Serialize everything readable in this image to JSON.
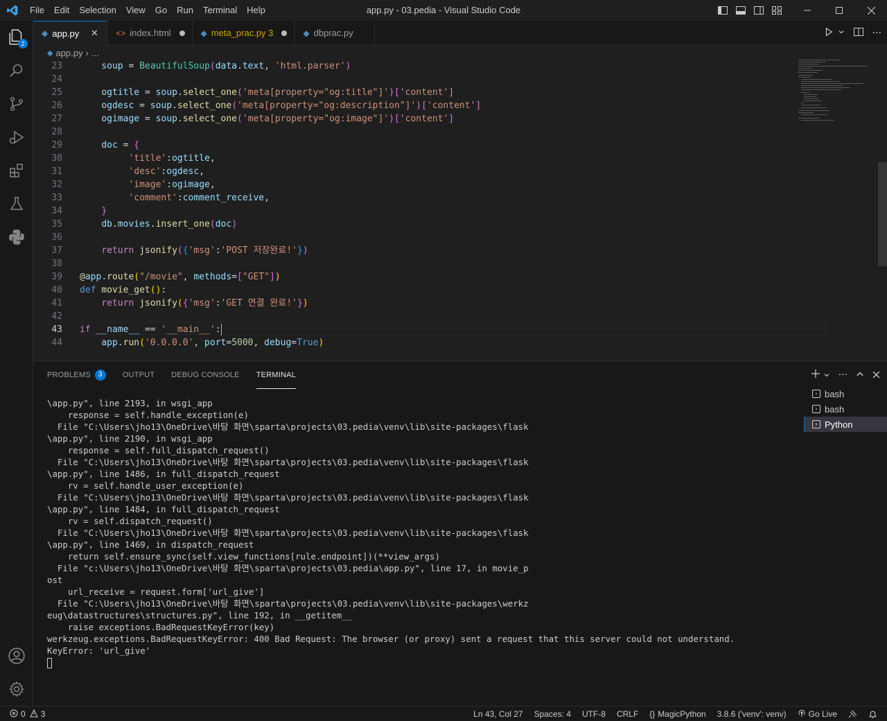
{
  "titlebar": {
    "menu": [
      "File",
      "Edit",
      "Selection",
      "View",
      "Go",
      "Run",
      "Terminal",
      "Help"
    ],
    "title": "app.py - 03.pedia - Visual Studio Code"
  },
  "activitybar": {
    "explorer_badge": "2"
  },
  "tabs": [
    {
      "label": "app.py",
      "icon": "python-icon",
      "state": "active"
    },
    {
      "label": "index.html",
      "icon": "html-icon",
      "state": "modified"
    },
    {
      "label": "meta_prac.py 3",
      "icon": "python-icon",
      "state": "modified-error"
    },
    {
      "label": "dbprac.py",
      "icon": "python-icon",
      "state": "normal"
    }
  ],
  "breadcrumb": {
    "file": "app.py",
    "rest": "..."
  },
  "editor": {
    "line_numbers": [
      "23",
      "24",
      "25",
      "26",
      "27",
      "28",
      "29",
      "30",
      "31",
      "32",
      "33",
      "34",
      "35",
      "36",
      "37",
      "38",
      "39",
      "40",
      "41",
      "42",
      "43",
      "44"
    ],
    "current_line": "43"
  },
  "panel": {
    "tabs": [
      "PROBLEMS",
      "OUTPUT",
      "DEBUG CONSOLE",
      "TERMINAL"
    ],
    "problems_count": "3",
    "terminals": [
      "bash",
      "bash",
      "Python"
    ],
    "terminal_lines": [
      "\\app.py\", line 2193, in wsgi_app",
      "    response = self.handle_exception(e)",
      "  File \"C:\\Users\\jho13\\OneDrive\\바탕 화면\\sparta\\projects\\03.pedia\\venv\\lib\\site-packages\\flask",
      "\\app.py\", line 2190, in wsgi_app",
      "    response = self.full_dispatch_request()",
      "  File \"C:\\Users\\jho13\\OneDrive\\바탕 화면\\sparta\\projects\\03.pedia\\venv\\lib\\site-packages\\flask",
      "\\app.py\", line 1486, in full_dispatch_request",
      "    rv = self.handle_user_exception(e)",
      "  File \"C:\\Users\\jho13\\OneDrive\\바탕 화면\\sparta\\projects\\03.pedia\\venv\\lib\\site-packages\\flask",
      "\\app.py\", line 1484, in full_dispatch_request",
      "    rv = self.dispatch_request()",
      "  File \"C:\\Users\\jho13\\OneDrive\\바탕 화면\\sparta\\projects\\03.pedia\\venv\\lib\\site-packages\\flask",
      "\\app.py\", line 1469, in dispatch_request",
      "    return self.ensure_sync(self.view_functions[rule.endpoint])(**view_args)",
      "  File \"c:\\Users\\jho13\\OneDrive\\바탕 화면\\sparta\\projects\\03.pedia\\app.py\", line 17, in movie_p",
      "ost",
      "    url_receive = request.form['url_give']",
      "  File \"C:\\Users\\jho13\\OneDrive\\바탕 화면\\sparta\\projects\\03.pedia\\venv\\lib\\site-packages\\werkz",
      "eug\\datastructures\\structures.py\", line 192, in __getitem__",
      "    raise exceptions.BadRequestKeyError(key)",
      "werkzeug.exceptions.BadRequestKeyError: 400 Bad Request: The browser (or proxy) sent a request that this server could not understand.",
      "KeyError: 'url_give'"
    ]
  },
  "statusbar": {
    "errors": "0",
    "warnings": "3",
    "position": "Ln 43, Col 27",
    "spaces": "Spaces: 4",
    "encoding": "UTF-8",
    "eol": "CRLF",
    "language": "MagicPython",
    "interpreter": "3.8.6 ('venv': venv)",
    "golive": "Go Live"
  },
  "colors": {
    "accent": "#0078d4",
    "background": "#1f1f1f",
    "sidebar": "#181818"
  }
}
